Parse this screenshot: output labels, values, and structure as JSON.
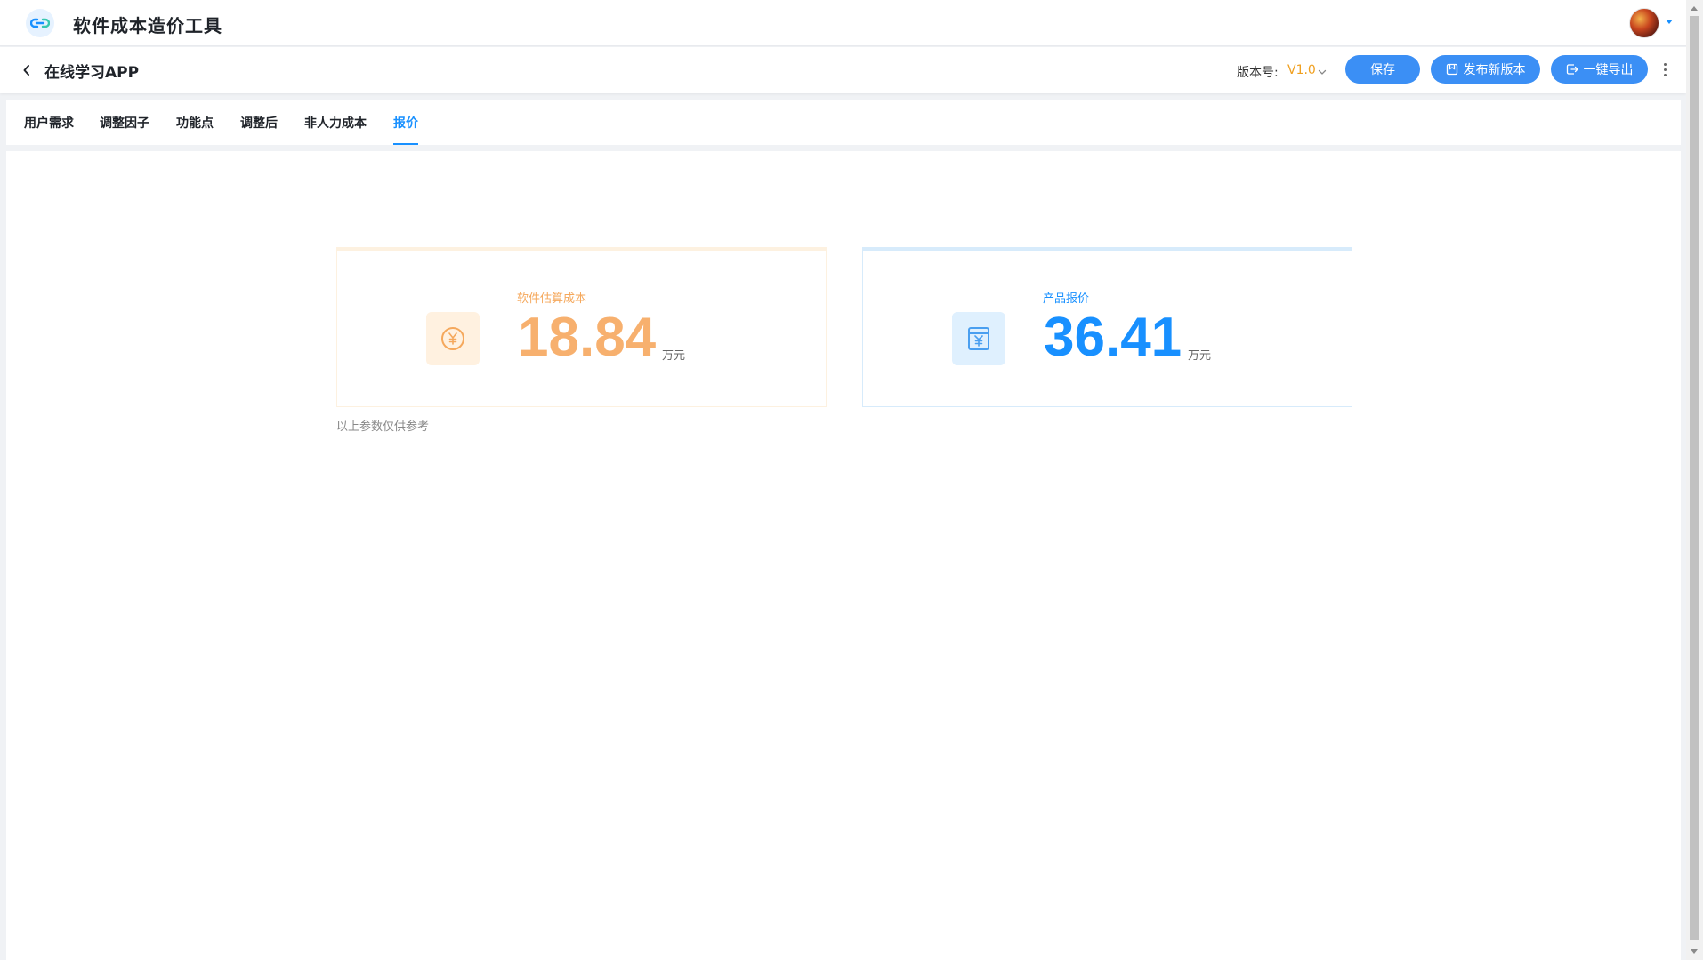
{
  "app": {
    "title": "软件成本造价工具"
  },
  "header": {
    "project_title": "在线学习APP",
    "version_label": "版本号:",
    "version_value": "V1.0",
    "save_label": "保存",
    "publish_label": "发布新版本",
    "export_label": "一键导出"
  },
  "tabs": [
    {
      "label": "用户需求",
      "active": false
    },
    {
      "label": "调整因子",
      "active": false
    },
    {
      "label": "功能点",
      "active": false
    },
    {
      "label": "调整后",
      "active": false
    },
    {
      "label": "非人力成本",
      "active": false
    },
    {
      "label": "报价",
      "active": true
    }
  ],
  "cards": {
    "cost": {
      "label": "软件估算成本",
      "value": "18.84",
      "unit": "万元",
      "icon": "yen-coin-icon"
    },
    "quote": {
      "label": "产品报价",
      "value": "36.41",
      "unit": "万元",
      "icon": "yen-invoice-icon"
    }
  },
  "note": "以上参数仅供参考",
  "colors": {
    "primary": "#1890ff",
    "button": "#3b8ff5",
    "cost_accent": "#f7b06e",
    "version_accent": "#f0a020"
  }
}
